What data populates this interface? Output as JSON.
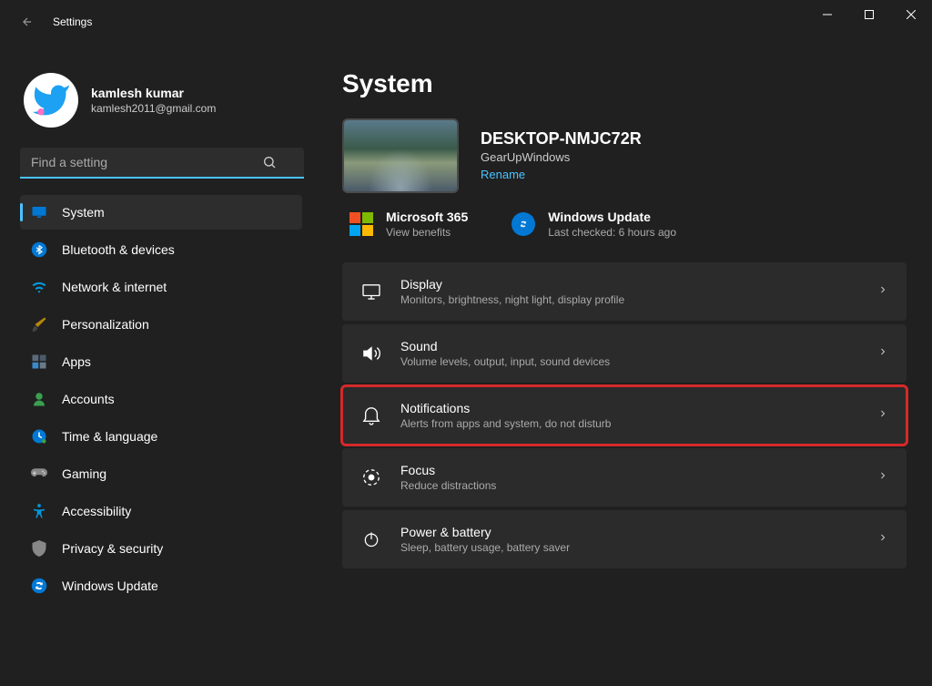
{
  "app": {
    "title": "Settings"
  },
  "user": {
    "name": "kamlesh kumar",
    "email": "kamlesh2011@gmail.com"
  },
  "search": {
    "placeholder": "Find a setting"
  },
  "nav": {
    "items": [
      {
        "label": "System",
        "icon": "monitor",
        "active": true
      },
      {
        "label": "Bluetooth & devices",
        "icon": "bluetooth"
      },
      {
        "label": "Network & internet",
        "icon": "wifi"
      },
      {
        "label": "Personalization",
        "icon": "brush"
      },
      {
        "label": "Apps",
        "icon": "apps"
      },
      {
        "label": "Accounts",
        "icon": "person"
      },
      {
        "label": "Time & language",
        "icon": "clock"
      },
      {
        "label": "Gaming",
        "icon": "gamepad"
      },
      {
        "label": "Accessibility",
        "icon": "accessibility"
      },
      {
        "label": "Privacy & security",
        "icon": "shield"
      },
      {
        "label": "Windows Update",
        "icon": "sync"
      }
    ]
  },
  "page": {
    "title": "System"
  },
  "device": {
    "name": "DESKTOP-NMJC72R",
    "sub": "GearUpWindows",
    "rename": "Rename"
  },
  "info": {
    "ms365": {
      "title": "Microsoft 365",
      "sub": "View benefits"
    },
    "update": {
      "title": "Windows Update",
      "sub": "Last checked: 6 hours ago"
    }
  },
  "cards": [
    {
      "title": "Display",
      "sub": "Monitors, brightness, night light, display profile",
      "icon": "display"
    },
    {
      "title": "Sound",
      "sub": "Volume levels, output, input, sound devices",
      "icon": "sound"
    },
    {
      "title": "Notifications",
      "sub": "Alerts from apps and system, do not disturb",
      "icon": "bell",
      "highlighted": true
    },
    {
      "title": "Focus",
      "sub": "Reduce distractions",
      "icon": "focus"
    },
    {
      "title": "Power & battery",
      "sub": "Sleep, battery usage, battery saver",
      "icon": "power"
    }
  ]
}
